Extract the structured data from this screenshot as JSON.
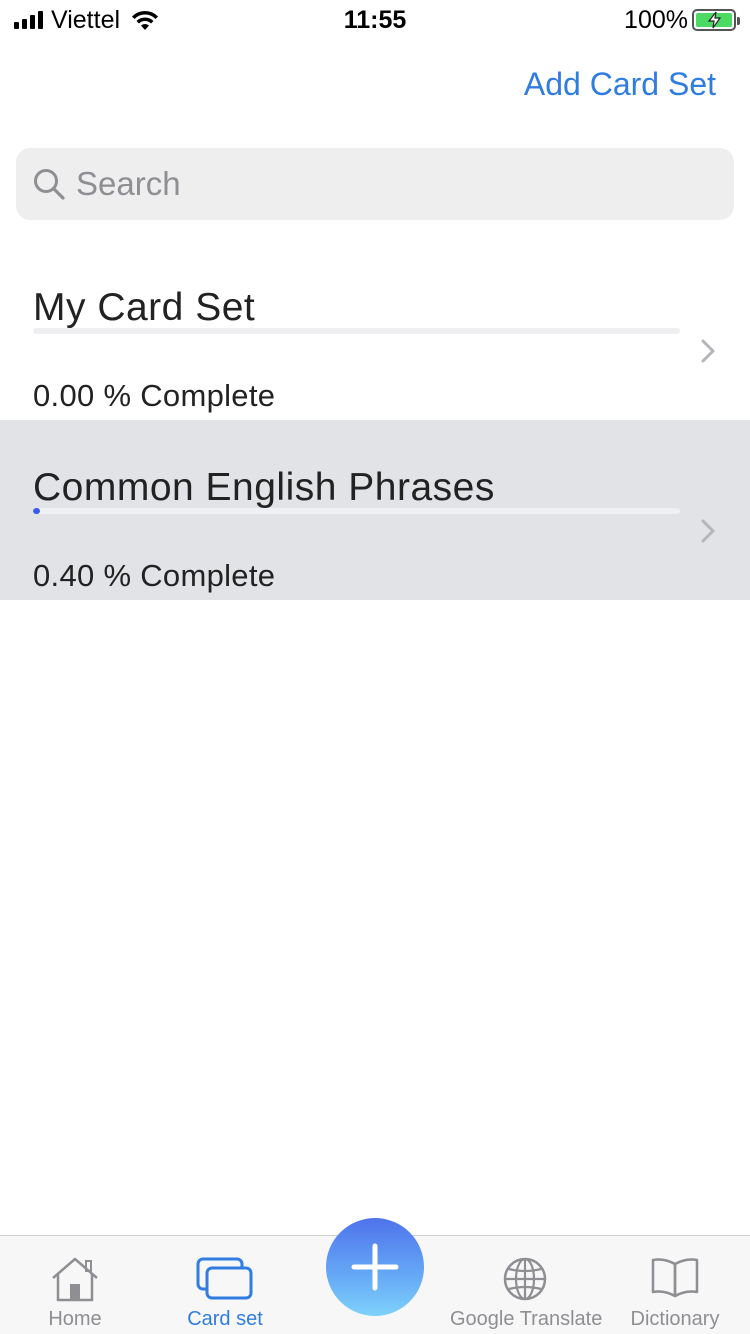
{
  "status_bar": {
    "carrier": "Viettel",
    "time": "11:55",
    "battery_percent": "100%",
    "battery_level": 1.0
  },
  "nav": {
    "add_card_set_label": "Add Card Set"
  },
  "search": {
    "placeholder": "Search"
  },
  "card_sets": [
    {
      "title": "My Card Set",
      "progress_text": "0.00 % Complete",
      "progress": 0.0
    },
    {
      "title": "Common English Phrases",
      "progress_text": "0.40 % Complete",
      "progress": 0.004
    }
  ],
  "tab_bar": {
    "tabs": [
      {
        "label": "Home",
        "icon": "home-icon"
      },
      {
        "label": "Card set",
        "icon": "card-set-icon",
        "active": true
      },
      {
        "label": "",
        "icon": "plus-icon"
      },
      {
        "label": "Google Translate",
        "icon": "globe-icon"
      },
      {
        "label": "Dictionary",
        "icon": "book-icon"
      }
    ]
  },
  "colors": {
    "accent": "#2f7de1",
    "progress": "#3b5bf0",
    "selected_row": "#e1e3e7",
    "search_bg": "#eeeeef"
  }
}
